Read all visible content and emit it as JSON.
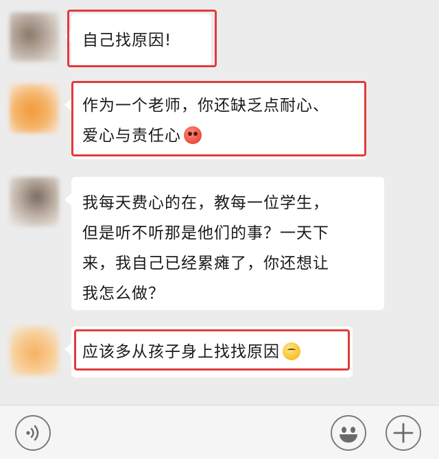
{
  "messages": [
    {
      "avatar_name": "avatar-1",
      "lines": [
        "自己找原因!"
      ],
      "emoji": null,
      "highlighted": true
    },
    {
      "avatar_name": "avatar-2",
      "lines": [
        "作为一个老师，你还缺乏点耐心、",
        "爱心与责任心"
      ],
      "emoji": "angry-face-icon",
      "highlighted": true
    },
    {
      "avatar_name": "avatar-3",
      "lines": [
        "我每天费心的在，教每一位学生，",
        "但是听不听那是他们的事？一天下",
        "来，我自己已经累瘫了，你还想让",
        "我怎么做？"
      ],
      "emoji": null,
      "highlighted": false
    },
    {
      "avatar_name": "avatar-4",
      "lines": [
        "应该多从孩子身上找找原因"
      ],
      "emoji": "thinking-face-icon",
      "highlighted": true
    }
  ],
  "input_bar": {
    "voice_icon": "voice-icon",
    "emoji_icon": "emoji-icon",
    "plus_icon": "plus-icon"
  },
  "colors": {
    "background": "#ececec",
    "bubble": "#ffffff",
    "highlight": "#e23a3a"
  }
}
